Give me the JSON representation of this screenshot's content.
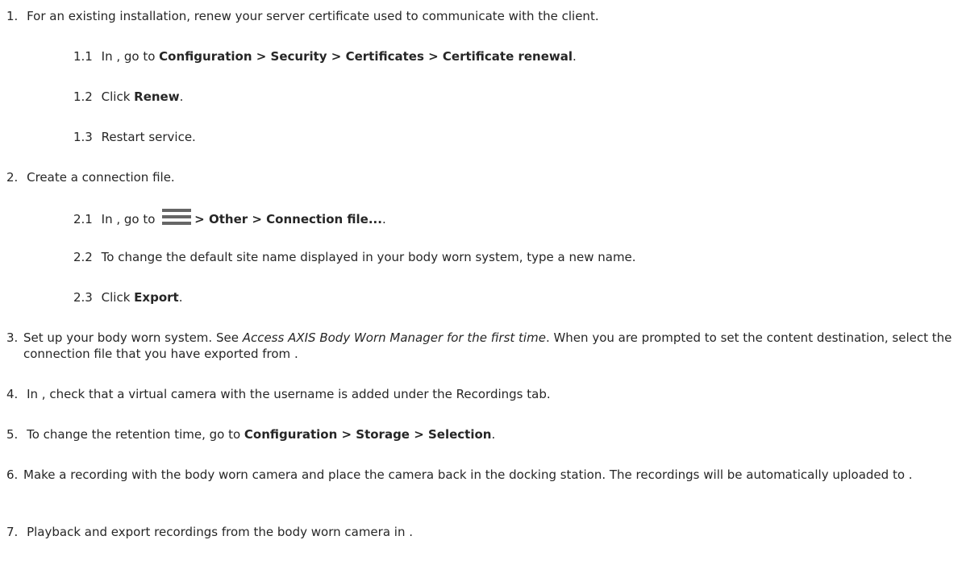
{
  "steps": [
    {
      "num": "1.",
      "text": "For an existing installation, renew your server certificate used to communicate with the client."
    },
    {
      "num": "2.",
      "text": "Create a connection file."
    },
    {
      "num": "3.",
      "text_a": "Set up your body worn system. See ",
      "link": "Access AXIS Body Worn Manager for the first time",
      "text_b": ". When you are prompted to set the content destination, select the connection file that you have exported from ."
    },
    {
      "num": "4.",
      "text": "In , check that a virtual camera with the username is added under the Recordings tab."
    },
    {
      "num": "5.",
      "text_a": "To change the retention time, go to ",
      "bold": "Configuration > Storage > Selection",
      "text_b": "."
    },
    {
      "num": "6.",
      "text": "Make a recording with the body worn camera and place the camera back in the docking station. The recordings will be automatically uploaded to ."
    },
    {
      "num": "7.",
      "text": "Playback and export recordings from the body worn camera in ."
    }
  ],
  "substeps": {
    "s11": {
      "num": "1.1",
      "text_a": "In , go to ",
      "bold": "Configuration > Security > Certificates > Certificate renewal",
      "text_b": "."
    },
    "s12": {
      "num": "1.2",
      "text_a": "Click ",
      "bold": "Renew",
      "text_b": "."
    },
    "s13": {
      "num": "1.3",
      "text": "Restart service."
    },
    "s21": {
      "num": "2.1",
      "text_a": "In , go to ",
      "icon": "hamburger-menu-icon",
      "bold": "> Other > Connection file...",
      "text_b": "."
    },
    "s22": {
      "num": "2.2",
      "text": "To change the default site name displayed in your body worn system, type a new name."
    },
    "s23": {
      "num": "2.3",
      "text_a": "Click ",
      "bold": "Export",
      "text_b": "."
    }
  }
}
